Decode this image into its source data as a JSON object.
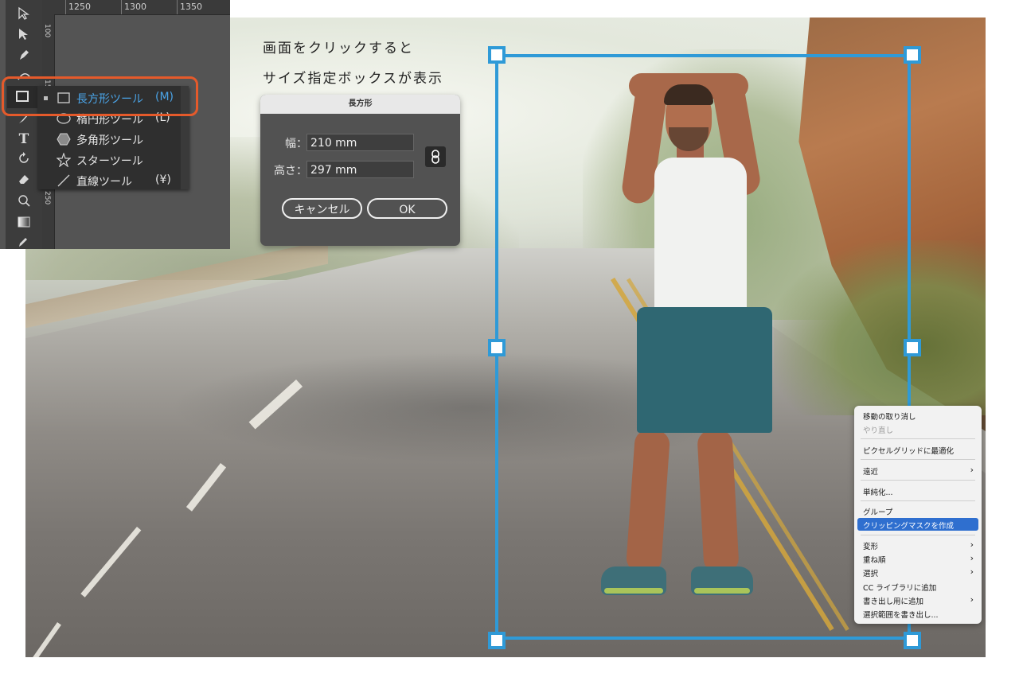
{
  "annotation": {
    "line1": "画面をクリックすると",
    "line2": "サイズ指定ボックスが表示"
  },
  "ruler": {
    "top_marks": [
      "1250",
      "1300",
      "1350"
    ],
    "left_marks": [
      "100",
      "150",
      "200",
      "250"
    ]
  },
  "tools": {
    "icons": [
      "selection-arrow-icon",
      "direct-selection-icon",
      "pen-icon",
      "curvature-icon",
      "rectangle-icon",
      "paintbrush-icon",
      "type-icon",
      "rotate-icon",
      "eraser-icon",
      "shape-builder-icon",
      "gradient-icon",
      "eyedropper-icon"
    ],
    "flyout": [
      {
        "label": "長方形ツール",
        "shortcut": "(M)",
        "icon": "rectangle-icon",
        "active": true
      },
      {
        "label": "楕円形ツール",
        "shortcut": "(L)",
        "icon": "ellipse-icon",
        "active": false
      },
      {
        "label": "多角形ツール",
        "shortcut": "",
        "icon": "polygon-icon",
        "active": false
      },
      {
        "label": "スターツール",
        "shortcut": "",
        "icon": "star-icon",
        "active": false
      },
      {
        "label": "直線ツール",
        "shortcut": "(¥)",
        "icon": "line-icon",
        "active": false
      }
    ]
  },
  "dialog": {
    "title": "長方形",
    "width_label": "幅：",
    "width_value": "210 mm",
    "height_label": "高さ：",
    "height_value": "297 mm",
    "cancel_label": "キャンセル",
    "ok_label": "OK"
  },
  "context_menu": {
    "items": [
      {
        "label": "移動の取り消し",
        "submenu": false,
        "disabled": false
      },
      {
        "label": "やり直し",
        "submenu": false,
        "disabled": true
      },
      {
        "label": "ピクセルグリッドに最適化",
        "submenu": false,
        "disabled": false
      },
      {
        "label": "遠近",
        "submenu": true,
        "disabled": false
      },
      {
        "label": "単純化...",
        "submenu": false,
        "disabled": false
      },
      {
        "label": "グループ",
        "submenu": false,
        "disabled": false
      },
      {
        "label": "クリッピングマスクを作成",
        "submenu": false,
        "disabled": false,
        "highlighted": true
      },
      {
        "label": "変形",
        "submenu": true,
        "disabled": false
      },
      {
        "label": "重ね順",
        "submenu": true,
        "disabled": false
      },
      {
        "label": "選択",
        "submenu": true,
        "disabled": false
      },
      {
        "label": "CC ライブラリに追加",
        "submenu": false,
        "disabled": false
      },
      {
        "label": "書き出し用に追加",
        "submenu": true,
        "disabled": false
      },
      {
        "label": "選択範囲を書き出し...",
        "submenu": false,
        "disabled": false
      }
    ]
  },
  "colors": {
    "selection": "#2f9ad7",
    "callout": "#e55a2b",
    "menu_highlight": "#2f6fcf",
    "active_tool_text": "#4aa3e6"
  }
}
